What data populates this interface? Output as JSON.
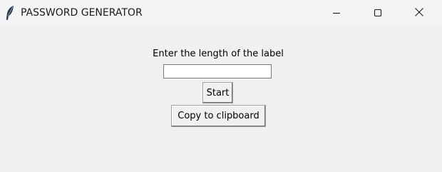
{
  "window": {
    "title": "PASSWORD GENERATOR",
    "app_icon": "feather-icon",
    "controls": {
      "minimize_icon": "minimize-icon",
      "maximize_icon": "maximize-icon",
      "close_icon": "close-icon"
    }
  },
  "form": {
    "prompt_label": "Enter the length of the label",
    "length_input": {
      "value": "",
      "placeholder": ""
    },
    "start_label": "Start",
    "copy_label": "Copy to clipboard"
  },
  "colors": {
    "background": "#f0f0f0",
    "titlebar": "#f3f4f6"
  }
}
